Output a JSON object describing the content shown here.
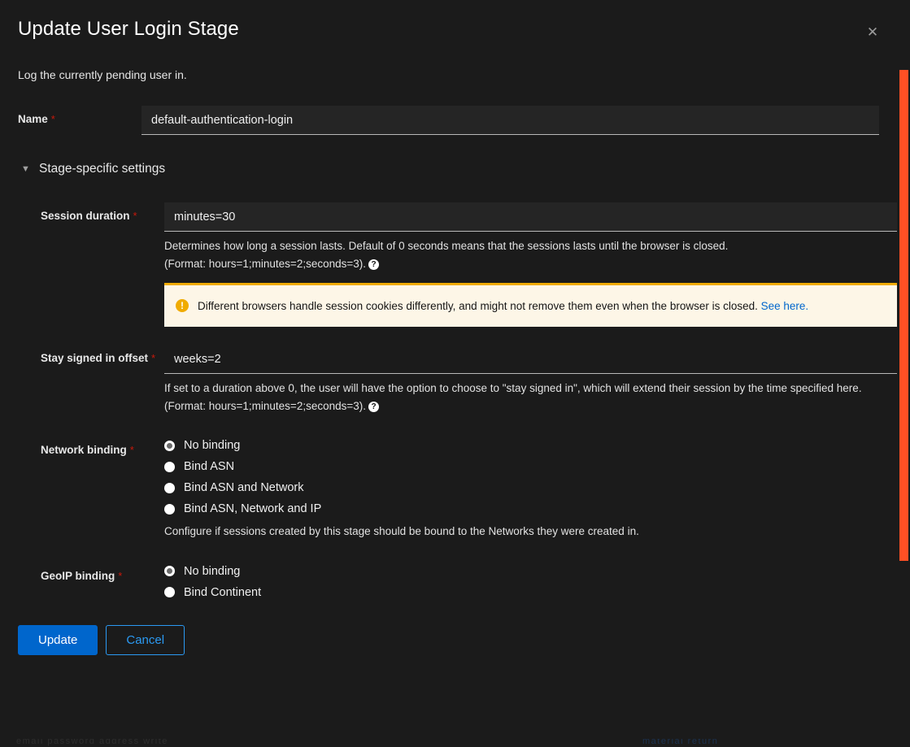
{
  "modal": {
    "title": "Update User Login Stage",
    "close_icon": "close-icon",
    "description": "Log the currently pending user in."
  },
  "name_field": {
    "label": "Name",
    "required_marker": "*",
    "value": "default-authentication-login",
    "placeholder": ""
  },
  "section": {
    "chevron_icon": "chevron-down-icon",
    "title": "Stage-specific settings"
  },
  "session_duration": {
    "label": "Session duration",
    "required_marker": "*",
    "value": "minutes=30",
    "help_line1": "Determines how long a session lasts. Default of 0 seconds means that the sessions lasts until the browser is closed.",
    "help_line2": "(Format: hours=1;minutes=2;seconds=3).",
    "help_icon": "?"
  },
  "warning": {
    "icon": "exclamation-circle-icon",
    "text": "Different browsers handle session cookies differently, and might not remove them even when the browser is closed. ",
    "link_text": "See here.",
    "border_color": "#f0ab00",
    "background_color": "#fdf6e7",
    "link_color": "#0066cc"
  },
  "stay_signed_in": {
    "label": "Stay signed in offset",
    "required_marker": "*",
    "value": "weeks=2",
    "help_line1": "If set to a duration above 0, the user will have the option to choose to \"stay signed in\", which will extend their session by the time specified here.",
    "help_line2": "(Format: hours=1;minutes=2;seconds=3).",
    "help_icon": "?"
  },
  "network_binding": {
    "label": "Network binding",
    "required_marker": "*",
    "options": [
      {
        "label": "No binding",
        "selected": true
      },
      {
        "label": "Bind ASN",
        "selected": false
      },
      {
        "label": "Bind ASN and Network",
        "selected": false
      },
      {
        "label": "Bind ASN, Network and IP",
        "selected": false
      }
    ],
    "help": "Configure if sessions created by this stage should be bound to the Networks they were created in."
  },
  "geoip_binding": {
    "label": "GeoIP binding",
    "required_marker": "*",
    "options": [
      {
        "label": "No binding",
        "selected": true
      },
      {
        "label": "Bind Continent",
        "selected": false
      }
    ]
  },
  "footer": {
    "update_label": "Update",
    "cancel_label": "Cancel",
    "primary_color": "#0066cc",
    "secondary_color": "#2b9af3"
  },
  "scrollbar": {
    "thumb_color": "#ff5024"
  },
  "background_peek": {
    "left_text": "email password address write",
    "right_text": "material return"
  }
}
